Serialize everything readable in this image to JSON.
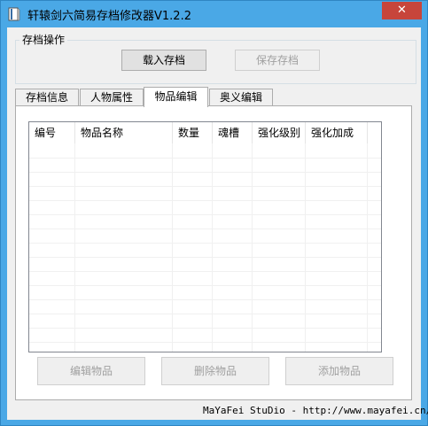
{
  "window": {
    "title": "轩辕剑六简易存档修改器V1.2.2",
    "close_glyph": "✕"
  },
  "save_ops": {
    "label": "存档操作",
    "load_label": "载入存档",
    "save_label": "保存存档",
    "save_enabled": false
  },
  "tabs": [
    {
      "label": "存档信息",
      "active": false
    },
    {
      "label": "人物属性",
      "active": false
    },
    {
      "label": "物品编辑",
      "active": true
    },
    {
      "label": "奥义编辑",
      "active": false
    }
  ],
  "item_table": {
    "columns": [
      "编号",
      "物品名称",
      "数量",
      "魂槽",
      "强化级别",
      "强化加成"
    ],
    "rows": []
  },
  "actions": {
    "edit_label": "编辑物品",
    "delete_label": "删除物品",
    "add_label": "添加物品",
    "enabled": false
  },
  "status": {
    "text": "MaYaFei StuDio - http://www.mayafei.cn/"
  },
  "colors": {
    "title_bar": "#4aa8e6",
    "close_button": "#c7453b",
    "client_bg": "#f0f0f0"
  },
  "icons": {
    "app": "book-icon",
    "close": "close-icon"
  }
}
